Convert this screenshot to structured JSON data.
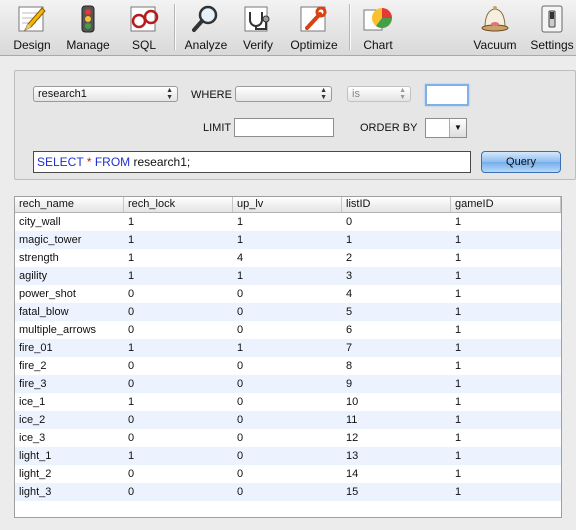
{
  "toolbar": {
    "left": [
      {
        "name": "design-button",
        "icon": "design-pencil-icon",
        "label": "Design"
      },
      {
        "name": "manage-button",
        "icon": "manage-traffic-light-icon",
        "label": "Manage"
      },
      {
        "name": "sql-button",
        "icon": "sql-glasses-icon",
        "label": "SQL"
      },
      {
        "name": "analyze-button",
        "icon": "analyze-magnifier-icon",
        "label": "Analyze"
      },
      {
        "name": "verify-button",
        "icon": "verify-stethoscope-icon",
        "label": "Verify"
      },
      {
        "name": "optimize-button",
        "icon": "optimize-wrench-icon",
        "label": "Optimize"
      },
      {
        "name": "chart-button",
        "icon": "chart-pie-icon",
        "label": "Chart"
      }
    ],
    "right": [
      {
        "name": "vacuum-button",
        "icon": "vacuum-bell-icon",
        "label": "Vacuum"
      },
      {
        "name": "settings-button",
        "icon": "settings-switch-icon",
        "label": "Settings"
      }
    ]
  },
  "query": {
    "table_select": "research1",
    "where_label": "WHERE",
    "where_column": "",
    "operator": "is",
    "where_value": "",
    "limit_label": "LIMIT",
    "limit_value": "",
    "order_label": "ORDER BY",
    "order_value": "",
    "sql_keyword_select": "SELECT",
    "sql_star": "*",
    "sql_keyword_from": "FROM",
    "sql_rest": "research1;",
    "query_button": "Query"
  },
  "results": {
    "columns": [
      "rech_name",
      "rech_lock",
      "up_lv",
      "listID",
      "gameID"
    ],
    "rows": [
      [
        "city_wall",
        "1",
        "1",
        "0",
        "1"
      ],
      [
        "magic_tower",
        "1",
        "1",
        "1",
        "1"
      ],
      [
        "strength",
        "1",
        "4",
        "2",
        "1"
      ],
      [
        "agility",
        "1",
        "1",
        "3",
        "1"
      ],
      [
        "power_shot",
        "0",
        "0",
        "4",
        "1"
      ],
      [
        "fatal_blow",
        "0",
        "0",
        "5",
        "1"
      ],
      [
        "multiple_arrows",
        "0",
        "0",
        "6",
        "1"
      ],
      [
        "fire_01",
        "1",
        "1",
        "7",
        "1"
      ],
      [
        "fire_2",
        "0",
        "0",
        "8",
        "1"
      ],
      [
        "fire_3",
        "0",
        "0",
        "9",
        "1"
      ],
      [
        "ice_1",
        "1",
        "0",
        "10",
        "1"
      ],
      [
        "ice_2",
        "0",
        "0",
        "11",
        "1"
      ],
      [
        "ice_3",
        "0",
        "0",
        "12",
        "1"
      ],
      [
        "light_1",
        "1",
        "0",
        "13",
        "1"
      ],
      [
        "light_2",
        "0",
        "0",
        "14",
        "1"
      ],
      [
        "light_3",
        "0",
        "0",
        "15",
        "1"
      ]
    ]
  },
  "colors": {
    "sql_keyword": "#1f2fd0",
    "sql_star": "#d01818",
    "row_alt": "#edf3fe",
    "query_button": "#8ebdf0"
  }
}
